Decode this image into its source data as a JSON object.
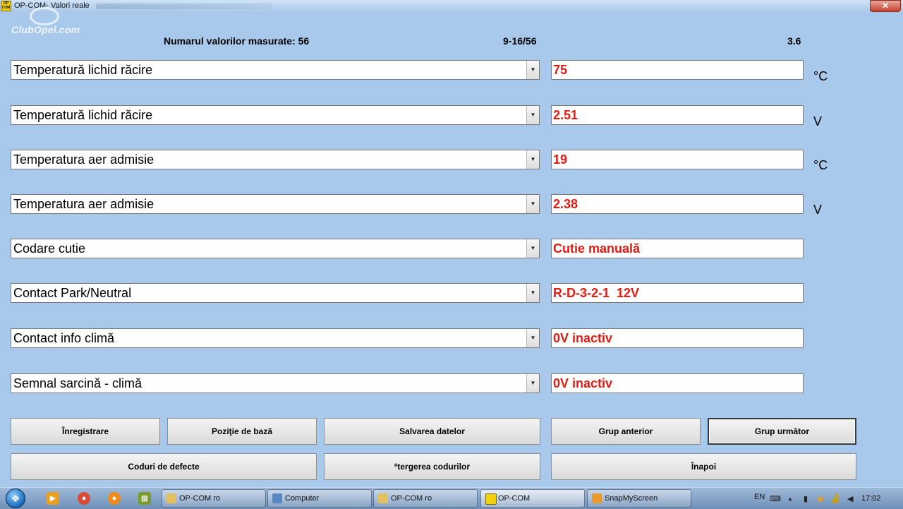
{
  "window": {
    "title": "OP-COM- Valori reale",
    "icon_text": "OP COM",
    "close_symbol": "✕"
  },
  "logo": {
    "text": "ClubOpel.com"
  },
  "header": {
    "count_label": "Numarul valorilor masurate: 56",
    "range": "9-16/56",
    "version": "3.6"
  },
  "rows": [
    {
      "label": "Temperatură lichid răcire",
      "value": "75",
      "unit": "°C"
    },
    {
      "label": "Temperatură lichid răcire",
      "value": "2.51",
      "unit": "V"
    },
    {
      "label": "Temperatura aer admisie",
      "value": "19",
      "unit": "°C"
    },
    {
      "label": "Temperatura aer admisie",
      "value": "2.38",
      "unit": "V"
    },
    {
      "label": "Codare cutie",
      "value": "Cutie manuală",
      "unit": ""
    },
    {
      "label": "Contact Park/Neutral",
      "value": "R-D-3-2-1  12V",
      "unit": ""
    },
    {
      "label": "Contact info climă",
      "value": "0V inactiv",
      "unit": ""
    },
    {
      "label": "Semnal sarcină - climă",
      "value": "0V inactiv",
      "unit": ""
    }
  ],
  "dropdown_arrow": "▼",
  "buttons": {
    "record": "Înregistrare",
    "base_position": "Poziţie de bază",
    "save_data": "Salvarea datelor",
    "previous_group": "Grup anterior",
    "next_group": "Grup următor",
    "fault_codes": "Coduri de defecte",
    "clear_codes": "ªtergerea codurilor",
    "back": "Înapoi"
  },
  "taskbar": {
    "start_symbol": "❖",
    "pinned": [
      {
        "icon": "media-player-icon",
        "symbol": "▶",
        "color": "#e8a020"
      },
      {
        "icon": "chrome-icon",
        "symbol": "●",
        "color": "#d94a38"
      },
      {
        "icon": "firefox-icon",
        "symbol": "●",
        "color": "#f08a1c"
      },
      {
        "icon": "calculator-icon",
        "symbol": "▦",
        "color": "#7a9a30"
      }
    ],
    "tasks": [
      {
        "label": "OP-COM ro",
        "icon_color": "#e2c060"
      },
      {
        "label": "Computer",
        "icon_color": "#5a86c4"
      },
      {
        "label": "OP-COM ro",
        "icon_color": "#e2c060"
      },
      {
        "label": "OP-COM",
        "icon_color": "#f1d20c"
      },
      {
        "label": "SnapMyScreen",
        "icon_color": "#e89b2c"
      }
    ],
    "tray": {
      "language": "EN",
      "keyboard_symbol": "⌨",
      "show_hidden_symbol": "▲",
      "battery_symbol": "▮",
      "app_symbol": "◉",
      "signal_symbol": "▟",
      "volume_symbol": "◀",
      "time": "17:02"
    }
  },
  "colors": {
    "background": "#a9c9ec",
    "value_text": "#e41b13"
  }
}
